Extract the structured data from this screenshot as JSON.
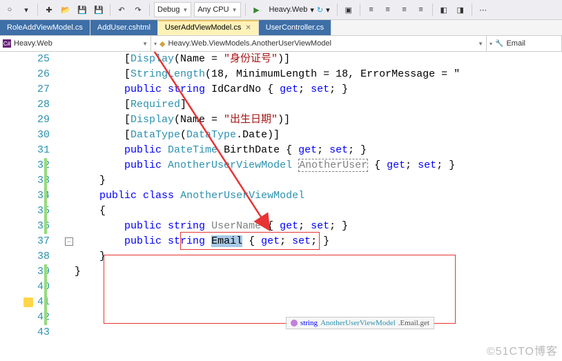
{
  "toolbar": {
    "config": "Debug",
    "platform": "Any CPU",
    "start_label": "Heavy.Web"
  },
  "tabs": [
    {
      "label": "RoleAddViewModel.cs",
      "active": false
    },
    {
      "label": "AddUser.cshtml",
      "active": false
    },
    {
      "label": "UserAddViewModel.cs",
      "active": true
    },
    {
      "label": "UserController.cs",
      "active": false
    }
  ],
  "nav": {
    "project": "Heavy.Web",
    "scope": "Heavy.Web.ViewModels.AnotherUserViewModel",
    "member": "Email"
  },
  "code": {
    "first_line": 25,
    "lines": [
      "[Display(Name = \"身份证号\")]",
      "[StringLength(18, MinimumLength = 18, ErrorMessage = \"",
      "public string IdCardNo { get; set; }",
      "",
      "[Required]",
      "[Display(Name = \"出生日期\")]",
      "[DataType(DataType.Date)]",
      "public DateTime BirthDate { get; set; }",
      "",
      "public AnotherUserViewModel AnotherUser { get; set; }",
      "}",
      "",
      "public class AnotherUserViewModel",
      "{",
      "public string UserName { get; set; }",
      "",
      "public string Email { get; set; }",
      "}",
      "}"
    ],
    "indent": [
      2,
      2,
      2,
      0,
      2,
      2,
      2,
      2,
      0,
      2,
      1,
      0,
      1,
      1,
      2,
      0,
      2,
      1,
      0
    ]
  },
  "tooltip": {
    "prefix": "string ",
    "type": "AnotherUserViewModel",
    "suffix": ".Email.get"
  },
  "watermark": "©51CTO博客",
  "chart_data": null
}
